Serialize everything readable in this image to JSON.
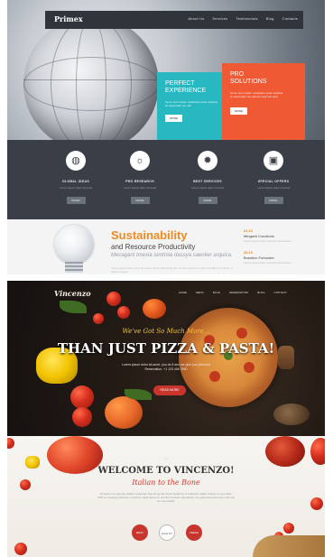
{
  "primex": {
    "logo": "Primex",
    "nav": [
      "About Us",
      "Services",
      "Testimonials",
      "Blog",
      "Contacts"
    ],
    "tile_left": {
      "title_line1": "PERFECT",
      "title_line2": "EXPERIENCE",
      "text": "Nemo enim ipsam voluptatem quia voluptas sit aspernatur aut odit",
      "button": "MORE"
    },
    "tile_right": {
      "title_line1": "PRO",
      "title_line2": "SOLUTIONS",
      "text": "Nemo enim ipsam voluptatem quia voluptas sit aspernatur aut odit aut fugit sed quia",
      "button": "MORE"
    },
    "features": [
      {
        "icon": "globe-icon",
        "glyph": "◍",
        "title": "GLOBAL IDEAS",
        "sub": "Lorem ipsum dolor sit amet",
        "button": "MORE"
      },
      {
        "icon": "lightbulb-icon",
        "glyph": "☼",
        "title": "PRO RESEARCH",
        "sub": "Lorem ipsum dolor sit amet",
        "button": "MORE"
      },
      {
        "icon": "gear-icon",
        "glyph": "✹",
        "title": "BEST SERVICES",
        "sub": "Lorem ipsum dolor sit amet",
        "button": "MORE"
      },
      {
        "icon": "briefcase-icon",
        "glyph": "▣",
        "title": "SPECIAL OFFERS",
        "sub": "Lorem ipsum dolor sit amet",
        "button": "MORE"
      }
    ],
    "sustain": {
      "title": "Sustainability",
      "subtitle": "and Resource Productivity",
      "italic": "Mecagant tmexia sentmia dassya saecker arquica.",
      "para": "Lorem ipsum dolor sit amet conse ctetur adipisicing elit, sed do eiusmod tempor incididunt ut labore et dolore magna."
    },
    "events": [
      {
        "date": "24.10",
        "name": "Mingseit Conctions",
        "text": "Lorem ipsum dolor sit amet consectetur"
      },
      {
        "date": "26.10",
        "name": "Boestico Fortunder",
        "text": "Lorem ipsum dolor sit amet consectetur"
      }
    ]
  },
  "vincenzo": {
    "logo": "Vincenzo",
    "nav": [
      "HOME",
      "MENU",
      "BLOG",
      "RESERVATION",
      "BLOG",
      "CONTACT"
    ],
    "script": "We've Got So Much More...",
    "headline": "THAN JUST PIZZA & PASTA!",
    "subtext_line1": "Lorem ipsum dolor sit amet, you do it and we give you pleasure",
    "subtext_line2": "Reservation: +1 123 456 7890",
    "button": "READ MORE"
  },
  "vincenzo_welcome": {
    "title": "WELCOME TO VINCENZO!",
    "script": "Italian to the Bone",
    "para": "Vincenzo is a genuine Italian restaurant that brings the finest traditions of authentic Italian cuisine to your table. With an amazing selection of dishes made with love and the freshest ingredients, we guarantee that every visit will be memorable.",
    "badges": [
      "BEST",
      "QUALITY",
      "FRESH"
    ]
  },
  "colors": {
    "teal": "#28b8c2",
    "orange": "#ef5a35",
    "accent_red": "#c8352d",
    "gold": "#f1c232"
  }
}
